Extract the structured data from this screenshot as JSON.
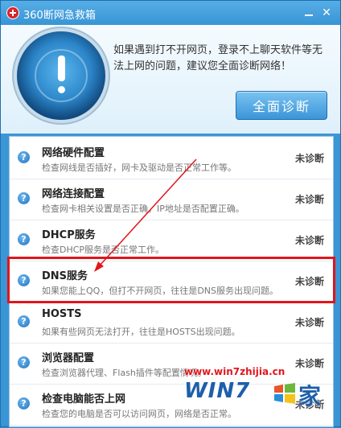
{
  "window": {
    "title": "360断网急救箱"
  },
  "header": {
    "intro": "如果遇到打不开网页，登录不上聊天软件等无法上网的问题，建议您全面诊断网络！",
    "full_scan_label": "全面诊断"
  },
  "items": [
    {
      "title": "网络硬件配置",
      "desc": "检查网线是否插好，网卡及驱动是否正常工作等。",
      "status": "未诊断"
    },
    {
      "title": "网络连接配置",
      "desc": "检查网卡相关设置是否正确，IP地址是否配置正确。",
      "status": "未诊断"
    },
    {
      "title": "DHCP服务",
      "desc": "检查DHCP服务是否正常工作。",
      "status": "未诊断"
    },
    {
      "title": "DNS服务",
      "desc": "如果您能上QQ，但打不开网页，往往是DNS服务出现问题。",
      "status": "未诊断"
    },
    {
      "title": "HOSTS",
      "desc": "如果有些网页无法打开，往往是HOSTS出现问题。",
      "status": "未诊断"
    },
    {
      "title": "浏览器配置",
      "desc": "检查浏览器代理、Flash插件等配置情况。",
      "status": "未诊断"
    },
    {
      "title": "检查电脑能否上网",
      "desc": "检查您的电脑是否可以访问网页，网络是否正常。",
      "status": "未诊断"
    }
  ],
  "watermark": {
    "url": "www.win7zhijia.cn",
    "logo": "WIN7",
    "char": "家"
  },
  "colors": {
    "accent": "#3a95d5",
    "highlight": "#e0161b"
  }
}
